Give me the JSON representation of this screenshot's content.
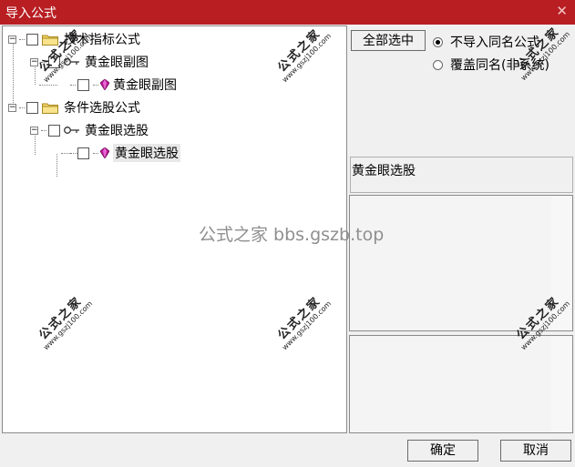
{
  "window": {
    "title": "导入公式",
    "close_glyph": "✕"
  },
  "tree": {
    "items": [
      {
        "label": "技术指标公式",
        "icon": "folder-icon",
        "expanded": true
      },
      {
        "label": "黄金眼副图",
        "icon": "key-icon",
        "expanded": true
      },
      {
        "label": "黄金眼副图",
        "icon": "gem-icon"
      },
      {
        "label": "条件选股公式",
        "icon": "folder-icon",
        "expanded": true
      },
      {
        "label": "黄金眼选股",
        "icon": "key-icon",
        "expanded": true
      },
      {
        "label": "黄金眼选股",
        "icon": "gem-icon",
        "selected": true
      }
    ],
    "expander_glyph": "−"
  },
  "options": {
    "select_all_label": "全部选中",
    "radio_skip_label": "不导入同名公式",
    "radio_overwrite_label": "覆盖同名(非系统)",
    "selected_radio": "skip"
  },
  "formula_name": "黄金眼选股",
  "buttons": {
    "ok": "确定",
    "cancel": "取消"
  },
  "watermark": {
    "stamp_title": "公式之家",
    "stamp_url": "www.gszj100.com",
    "center_text": "公式之家 bbs.gszb.top"
  },
  "colors": {
    "titlebar": "#b81e22",
    "folder": "#f2d46a",
    "gem": "#c0169b"
  }
}
